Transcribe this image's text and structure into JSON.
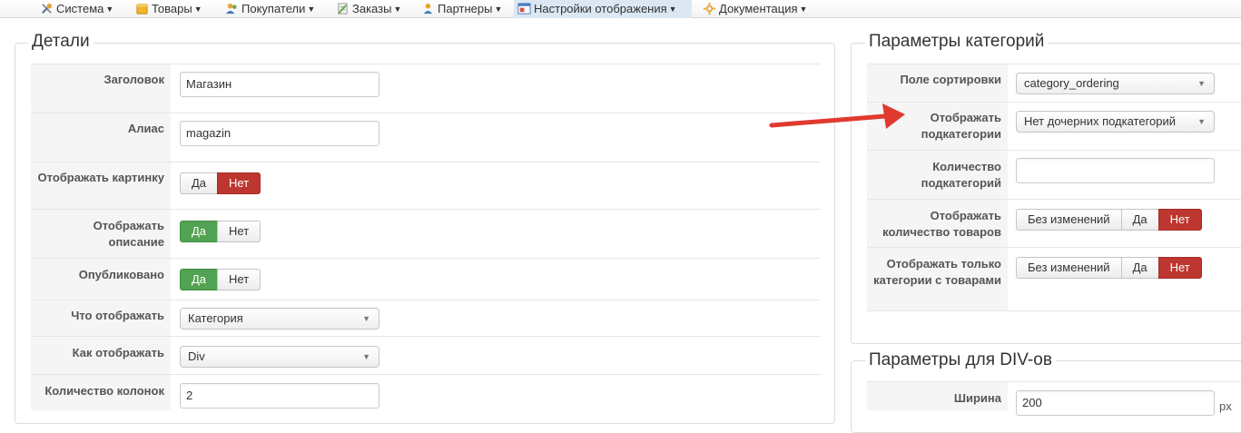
{
  "menu": {
    "items": [
      {
        "label": "Система",
        "icon": "wrench-icon"
      },
      {
        "label": "Товары",
        "icon": "box-icon"
      },
      {
        "label": "Покупатели",
        "icon": "users-icon"
      },
      {
        "label": "Заказы",
        "icon": "orders-icon"
      },
      {
        "label": "Партнеры",
        "icon": "partners-icon"
      },
      {
        "label": "Настройки отображения",
        "icon": "display-settings-icon",
        "active": true
      },
      {
        "label": "Документация",
        "icon": "documentation-icon"
      }
    ]
  },
  "details": {
    "legend": "Детали",
    "title_label": "Заголовок",
    "title_value": "Магазин",
    "alias_label": "Алиас",
    "alias_value": "magazin",
    "show_image_label": "Отображать картинку",
    "show_image_yes": "Да",
    "show_image_no": "Нет",
    "show_desc_label": "Отображать описание",
    "show_desc_yes": "Да",
    "show_desc_no": "Нет",
    "published_label": "Опубликовано",
    "published_yes": "Да",
    "published_no": "Нет",
    "what_label": "Что отображать",
    "what_value": "Категория",
    "how_label": "Как отображать",
    "how_value": "Div",
    "columns_label": "Количество колонок",
    "columns_value": "2"
  },
  "category_params": {
    "legend": "Параметры категорий",
    "sort_label": "Поле сортировки",
    "sort_value": "category_ordering",
    "show_sub_label": "Отображать подкатегории",
    "show_sub_value": "Нет дочерних подкатегорий",
    "sub_count_label": "Количество подкатегорий",
    "sub_count_value": "",
    "show_count_label": "Отображать количество товаров",
    "show_count_nochange": "Без изменений",
    "show_count_yes": "Да",
    "show_count_no": "Нет",
    "only_with_label": "Отображать только категории с товарами",
    "only_with_nochange": "Без изменений",
    "only_with_yes": "Да",
    "only_with_no": "Нет"
  },
  "div_params": {
    "legend": "Параметры для DIV-ов",
    "width_label": "Ширина",
    "width_value": "200",
    "width_unit": "px"
  },
  "colors": {
    "accent_active": "#dbe8f4",
    "no_active": "#bd362f",
    "yes_active": "#51a351",
    "annotation_arrow": "#e03a2f"
  }
}
